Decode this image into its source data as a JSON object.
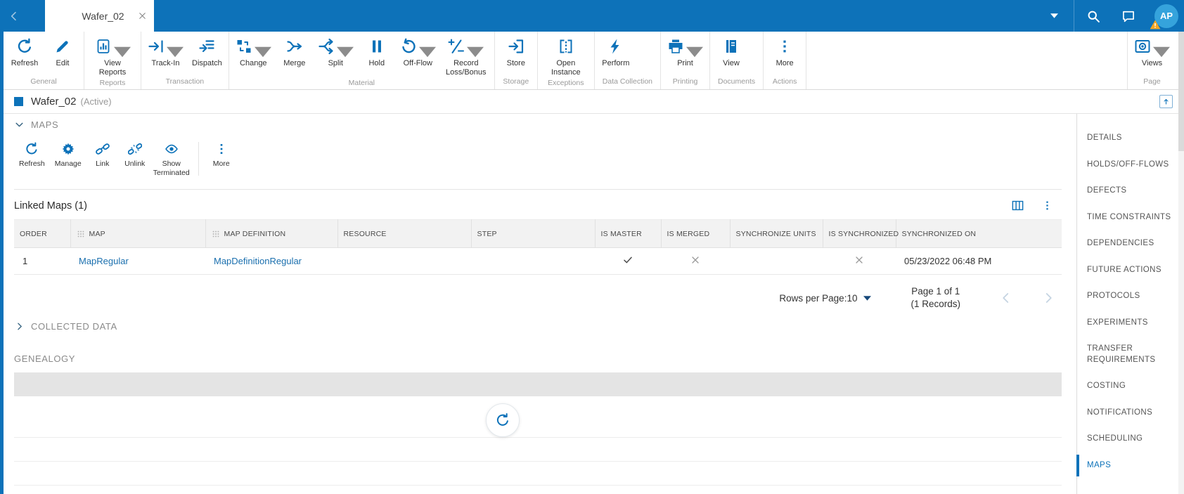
{
  "colors": {
    "primary_blue": "#0d72b9",
    "link_blue": "#1a6fae",
    "avatar_blue": "#35a3dc",
    "warning_yellow": "#f5a623"
  },
  "topbar": {
    "tab_title": "Wafer_02",
    "avatar_initials": "AP"
  },
  "ribbon": {
    "groups": [
      {
        "label": "General",
        "buttons": [
          {
            "label": "Refresh",
            "icon": "refresh-icon"
          },
          {
            "label": "Edit",
            "icon": "edit-icon"
          }
        ]
      },
      {
        "label": "Reports",
        "buttons": [
          {
            "label": "View Reports",
            "icon": "bar-chart-icon",
            "caret": true
          }
        ]
      },
      {
        "label": "Transaction",
        "buttons": [
          {
            "label": "Track-In",
            "icon": "track-in-icon",
            "caret": true
          },
          {
            "label": "Dispatch",
            "icon": "dispatch-icon"
          }
        ]
      },
      {
        "label": "Material",
        "buttons": [
          {
            "label": "Change",
            "icon": "change-icon",
            "caret": true
          },
          {
            "label": "Merge",
            "icon": "merge-icon"
          },
          {
            "label": "Split",
            "icon": "split-icon",
            "caret": true
          },
          {
            "label": "Hold",
            "icon": "hold-icon"
          },
          {
            "label": "Off-Flow",
            "icon": "off-flow-icon",
            "caret": true
          },
          {
            "label": "Record Loss/Bonus",
            "icon": "loss-bonus-icon",
            "caret": true
          }
        ]
      },
      {
        "label": "Storage",
        "buttons": [
          {
            "label": "Store",
            "icon": "store-icon"
          }
        ]
      },
      {
        "label": "Exceptions",
        "buttons": [
          {
            "label": "Open Instance",
            "icon": "open-instance-icon"
          }
        ]
      },
      {
        "label": "Data Collection",
        "buttons": [
          {
            "label": "Perform",
            "icon": "lightning-icon"
          }
        ]
      },
      {
        "label": "Printing",
        "buttons": [
          {
            "label": "Print",
            "icon": "printer-icon",
            "caret": true
          }
        ]
      },
      {
        "label": "Documents",
        "buttons": [
          {
            "label": "View",
            "icon": "book-icon"
          }
        ]
      },
      {
        "label": "Actions",
        "buttons": [
          {
            "label": "More",
            "icon": "more-dots-icon"
          }
        ]
      },
      {
        "label": "Page",
        "align": "right",
        "buttons": [
          {
            "label": "Views",
            "icon": "views-eye-icon",
            "caret": true
          }
        ]
      }
    ]
  },
  "entity": {
    "name": "Wafer_02",
    "status": "(Active)"
  },
  "maps_section": {
    "title": "MAPS",
    "toolbar": [
      {
        "label": "Refresh",
        "icon": "refresh-icon"
      },
      {
        "label": "Manage",
        "icon": "gear-icon"
      },
      {
        "label": "Link",
        "icon": "link-icon"
      },
      {
        "label": "Unlink",
        "icon": "unlink-icon"
      },
      {
        "label": "Show Terminated",
        "icon": "eye-icon"
      },
      {
        "label": "More",
        "icon": "more-dots-icon",
        "divider_before": true
      }
    ],
    "linked_maps_title": "Linked Maps (1)",
    "table": {
      "columns": [
        {
          "label": "ORDER"
        },
        {
          "label": "MAP",
          "drag_icon": true
        },
        {
          "label": "MAP DEFINITION",
          "drag_icon": true
        },
        {
          "label": "RESOURCE"
        },
        {
          "label": "STEP"
        },
        {
          "label": "IS MASTER"
        },
        {
          "label": "IS MERGED"
        },
        {
          "label": "SYNCHRONIZE UNITS"
        },
        {
          "label": "IS SYNCHRONIZED"
        },
        {
          "label": "SYNCHRONIZED ON"
        }
      ],
      "rows": [
        {
          "order": "1",
          "map": "MapRegular",
          "map_definition": "MapDefinitionRegular",
          "resource": "",
          "step": "",
          "is_master": "check",
          "is_merged": "cross",
          "synchronize_units": "",
          "is_synchronized": "cross",
          "synchronized_on": "05/23/2022 06:48 PM"
        }
      ]
    },
    "pagination": {
      "rows_per_page": "Rows per Page:10",
      "page": "Page 1 of 1",
      "records": "(1 Records)"
    }
  },
  "collected_data": {
    "title": "COLLECTED DATA"
  },
  "genealogy": {
    "title": "GENEALOGY"
  },
  "sidebar": {
    "items": [
      {
        "label": "DETAILS"
      },
      {
        "label": "HOLDS/OFF-FLOWS"
      },
      {
        "label": "DEFECTS"
      },
      {
        "label": "TIME CONSTRAINTS"
      },
      {
        "label": "DEPENDENCIES"
      },
      {
        "label": "FUTURE ACTIONS"
      },
      {
        "label": "PROTOCOLS"
      },
      {
        "label": "EXPERIMENTS"
      },
      {
        "label": "TRANSFER REQUIREMENTS"
      },
      {
        "label": "COSTING"
      },
      {
        "label": "NOTIFICATIONS"
      },
      {
        "label": "SCHEDULING"
      },
      {
        "label": "MAPS",
        "active": true
      }
    ]
  }
}
